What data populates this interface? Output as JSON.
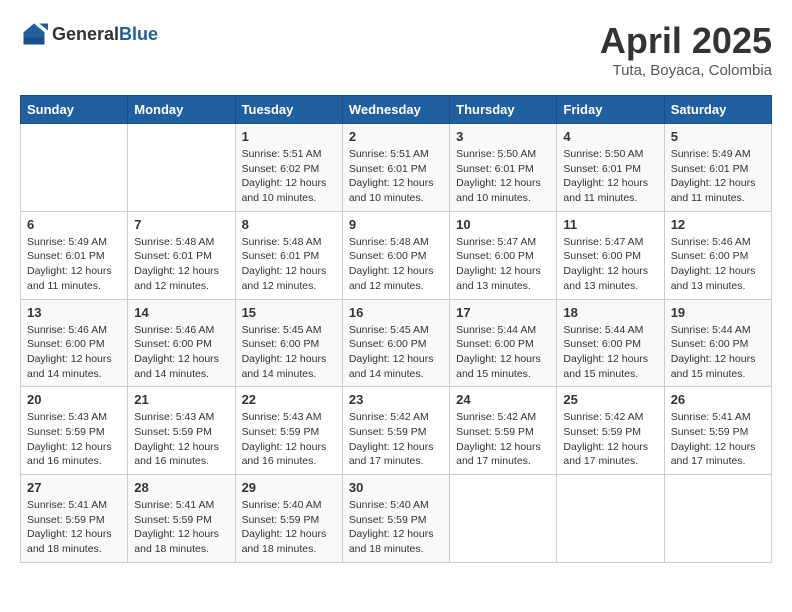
{
  "header": {
    "logo_general": "General",
    "logo_blue": "Blue",
    "month_title": "April 2025",
    "location": "Tuta, Boyaca, Colombia"
  },
  "days_of_week": [
    "Sunday",
    "Monday",
    "Tuesday",
    "Wednesday",
    "Thursday",
    "Friday",
    "Saturday"
  ],
  "weeks": [
    [
      null,
      null,
      {
        "day": 1,
        "sunrise": "5:51 AM",
        "sunset": "6:02 PM",
        "daylight": "12 hours and 10 minutes."
      },
      {
        "day": 2,
        "sunrise": "5:51 AM",
        "sunset": "6:01 PM",
        "daylight": "12 hours and 10 minutes."
      },
      {
        "day": 3,
        "sunrise": "5:50 AM",
        "sunset": "6:01 PM",
        "daylight": "12 hours and 10 minutes."
      },
      {
        "day": 4,
        "sunrise": "5:50 AM",
        "sunset": "6:01 PM",
        "daylight": "12 hours and 11 minutes."
      },
      {
        "day": 5,
        "sunrise": "5:49 AM",
        "sunset": "6:01 PM",
        "daylight": "12 hours and 11 minutes."
      }
    ],
    [
      {
        "day": 6,
        "sunrise": "5:49 AM",
        "sunset": "6:01 PM",
        "daylight": "12 hours and 11 minutes."
      },
      {
        "day": 7,
        "sunrise": "5:48 AM",
        "sunset": "6:01 PM",
        "daylight": "12 hours and 12 minutes."
      },
      {
        "day": 8,
        "sunrise": "5:48 AM",
        "sunset": "6:01 PM",
        "daylight": "12 hours and 12 minutes."
      },
      {
        "day": 9,
        "sunrise": "5:48 AM",
        "sunset": "6:00 PM",
        "daylight": "12 hours and 12 minutes."
      },
      {
        "day": 10,
        "sunrise": "5:47 AM",
        "sunset": "6:00 PM",
        "daylight": "12 hours and 13 minutes."
      },
      {
        "day": 11,
        "sunrise": "5:47 AM",
        "sunset": "6:00 PM",
        "daylight": "12 hours and 13 minutes."
      },
      {
        "day": 12,
        "sunrise": "5:46 AM",
        "sunset": "6:00 PM",
        "daylight": "12 hours and 13 minutes."
      }
    ],
    [
      {
        "day": 13,
        "sunrise": "5:46 AM",
        "sunset": "6:00 PM",
        "daylight": "12 hours and 14 minutes."
      },
      {
        "day": 14,
        "sunrise": "5:46 AM",
        "sunset": "6:00 PM",
        "daylight": "12 hours and 14 minutes."
      },
      {
        "day": 15,
        "sunrise": "5:45 AM",
        "sunset": "6:00 PM",
        "daylight": "12 hours and 14 minutes."
      },
      {
        "day": 16,
        "sunrise": "5:45 AM",
        "sunset": "6:00 PM",
        "daylight": "12 hours and 14 minutes."
      },
      {
        "day": 17,
        "sunrise": "5:44 AM",
        "sunset": "6:00 PM",
        "daylight": "12 hours and 15 minutes."
      },
      {
        "day": 18,
        "sunrise": "5:44 AM",
        "sunset": "6:00 PM",
        "daylight": "12 hours and 15 minutes."
      },
      {
        "day": 19,
        "sunrise": "5:44 AM",
        "sunset": "6:00 PM",
        "daylight": "12 hours and 15 minutes."
      }
    ],
    [
      {
        "day": 20,
        "sunrise": "5:43 AM",
        "sunset": "5:59 PM",
        "daylight": "12 hours and 16 minutes."
      },
      {
        "day": 21,
        "sunrise": "5:43 AM",
        "sunset": "5:59 PM",
        "daylight": "12 hours and 16 minutes."
      },
      {
        "day": 22,
        "sunrise": "5:43 AM",
        "sunset": "5:59 PM",
        "daylight": "12 hours and 16 minutes."
      },
      {
        "day": 23,
        "sunrise": "5:42 AM",
        "sunset": "5:59 PM",
        "daylight": "12 hours and 17 minutes."
      },
      {
        "day": 24,
        "sunrise": "5:42 AM",
        "sunset": "5:59 PM",
        "daylight": "12 hours and 17 minutes."
      },
      {
        "day": 25,
        "sunrise": "5:42 AM",
        "sunset": "5:59 PM",
        "daylight": "12 hours and 17 minutes."
      },
      {
        "day": 26,
        "sunrise": "5:41 AM",
        "sunset": "5:59 PM",
        "daylight": "12 hours and 17 minutes."
      }
    ],
    [
      {
        "day": 27,
        "sunrise": "5:41 AM",
        "sunset": "5:59 PM",
        "daylight": "12 hours and 18 minutes."
      },
      {
        "day": 28,
        "sunrise": "5:41 AM",
        "sunset": "5:59 PM",
        "daylight": "12 hours and 18 minutes."
      },
      {
        "day": 29,
        "sunrise": "5:40 AM",
        "sunset": "5:59 PM",
        "daylight": "12 hours and 18 minutes."
      },
      {
        "day": 30,
        "sunrise": "5:40 AM",
        "sunset": "5:59 PM",
        "daylight": "12 hours and 18 minutes."
      },
      null,
      null,
      null
    ]
  ]
}
